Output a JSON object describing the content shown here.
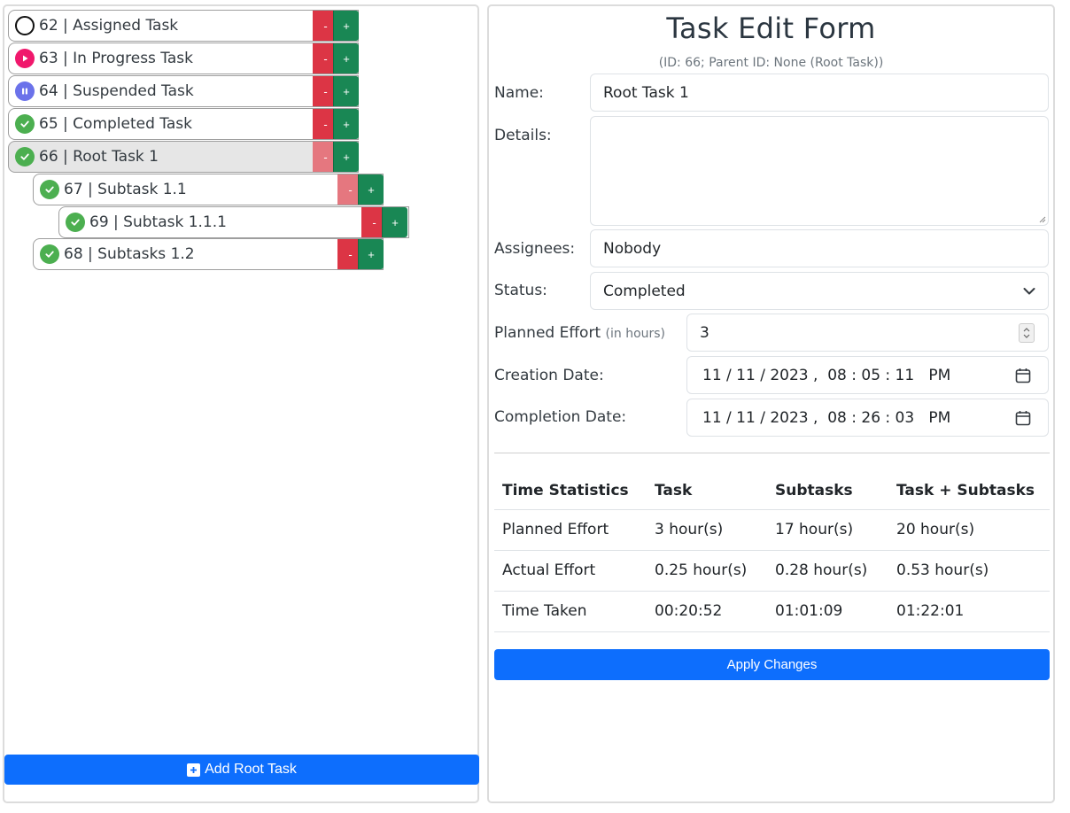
{
  "tree": {
    "tasks": [
      {
        "label": "62 | Assigned Task",
        "status": "assigned",
        "icon": "empty-circle-icon",
        "delete_label": "-",
        "add_label": "+"
      },
      {
        "label": "63 | In Progress Task",
        "status": "in-progress",
        "icon": "play-icon",
        "delete_label": "-",
        "add_label": "+"
      },
      {
        "label": "64 | Suspended Task",
        "status": "suspended",
        "icon": "pause-icon",
        "delete_label": "-",
        "add_label": "+"
      },
      {
        "label": "65 | Completed Task",
        "status": "completed",
        "icon": "check-icon",
        "delete_label": "-",
        "add_label": "+"
      },
      {
        "label": "66 | Root Task 1",
        "status": "completed",
        "icon": "check-icon",
        "selected": true,
        "delete_label": "-",
        "add_label": "+"
      },
      {
        "label": "67 | Subtask 1.1",
        "status": "completed",
        "icon": "check-icon",
        "delete_label": "-",
        "add_label": "+"
      },
      {
        "label": "69 | Subtask 1.1.1",
        "status": "completed",
        "icon": "check-icon",
        "delete_label": "-",
        "add_label": "+"
      },
      {
        "label": "68 | Subtasks 1.2",
        "status": "completed",
        "icon": "check-icon",
        "delete_label": "-",
        "add_label": "+"
      }
    ],
    "add_root_label": "Add Root Task"
  },
  "form": {
    "title": "Task Edit Form",
    "subtitle": "(ID: 66; Parent ID: None (Root Task))",
    "name_label": "Name:",
    "name_value": "Root Task 1",
    "details_label": "Details:",
    "details_value": "",
    "assignees_label": "Assignees:",
    "assignees_value": "Nobody",
    "status_label": "Status:",
    "status_value": "Completed",
    "planned_label": "Planned Effort",
    "planned_hint": "(in hours)",
    "planned_value": "3",
    "creation_label": "Creation Date:",
    "creation_value": "11 / 11 / 2023 ,  08 : 05 : 11   PM",
    "completion_label": "Completion Date:",
    "completion_value": "11 / 11 / 2023 ,  08 : 26 : 03   PM"
  },
  "stats": {
    "headers": [
      "Time Statistics",
      "Task",
      "Subtasks",
      "Task + Subtasks"
    ],
    "rows": [
      [
        "Planned Effort",
        "3 hour(s)",
        "17 hour(s)",
        "20 hour(s)"
      ],
      [
        "Actual Effort",
        "0.25 hour(s)",
        "0.28 hour(s)",
        "0.53 hour(s)"
      ],
      [
        "Time Taken",
        "00:20:52",
        "01:01:09",
        "01:22:01"
      ]
    ]
  },
  "apply_label": "Apply Changes",
  "colors": {
    "primary": "#0d6efd",
    "danger": "#dc3545",
    "success": "#198754",
    "status_completed": "#4caf50",
    "status_in_progress": "#f0186c",
    "status_suspended": "#6b72ea"
  }
}
